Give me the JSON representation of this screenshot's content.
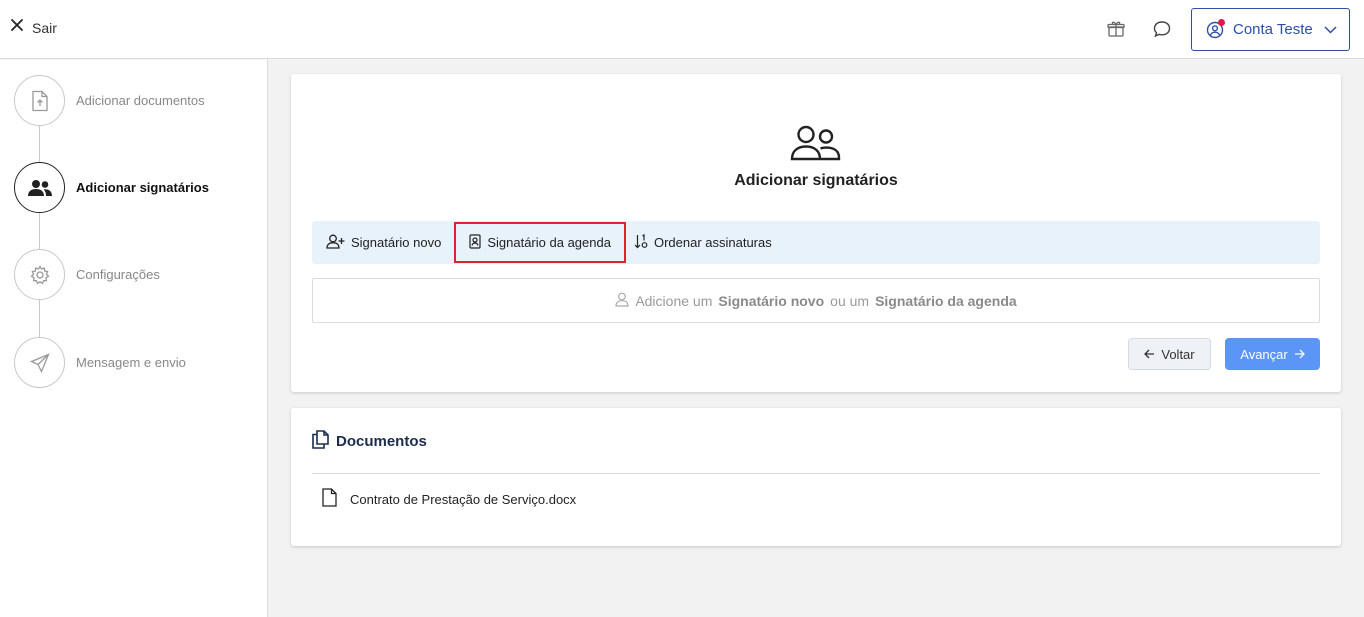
{
  "topbar": {
    "exit_label": "Sair",
    "account_label": "Conta Teste",
    "icons": [
      "close-icon",
      "gift-icon",
      "chat-icon",
      "user-circle-icon",
      "chevron-down-icon"
    ],
    "notification_color": "#e8154a",
    "accent_color": "#2d4fa8"
  },
  "sidebar": {
    "steps": [
      {
        "label": "Adicionar documentos",
        "icon": "file-upload-icon",
        "state": "inactive"
      },
      {
        "label": "Adicionar signatários",
        "icon": "users-icon",
        "state": "active"
      },
      {
        "label": "Configurações",
        "icon": "gear-icon",
        "state": "inactive"
      },
      {
        "label": "Mensagem e envio",
        "icon": "send-icon",
        "state": "inactive"
      }
    ]
  },
  "signers": {
    "title": "Adicionar signatários",
    "tabs": [
      {
        "label": "Signatário novo",
        "icon": "user-plus-icon"
      },
      {
        "label": "Signatário da agenda",
        "icon": "contact-book-icon",
        "highlighted": true
      },
      {
        "label": "Ordenar assinaturas",
        "icon": "sort-icon"
      }
    ],
    "empty": {
      "prefix": "Adicione um",
      "link1": "Signatário novo",
      "middle": "ou um",
      "link2": "Signatário da agenda"
    },
    "back_label": "Voltar",
    "next_label": "Avançar",
    "next_color": "#5b95f5",
    "highlight_color": "#e3202d"
  },
  "documents": {
    "title": "Documentos",
    "items": [
      {
        "name": "Contrato de Prestação de Serviço.docx"
      }
    ]
  }
}
